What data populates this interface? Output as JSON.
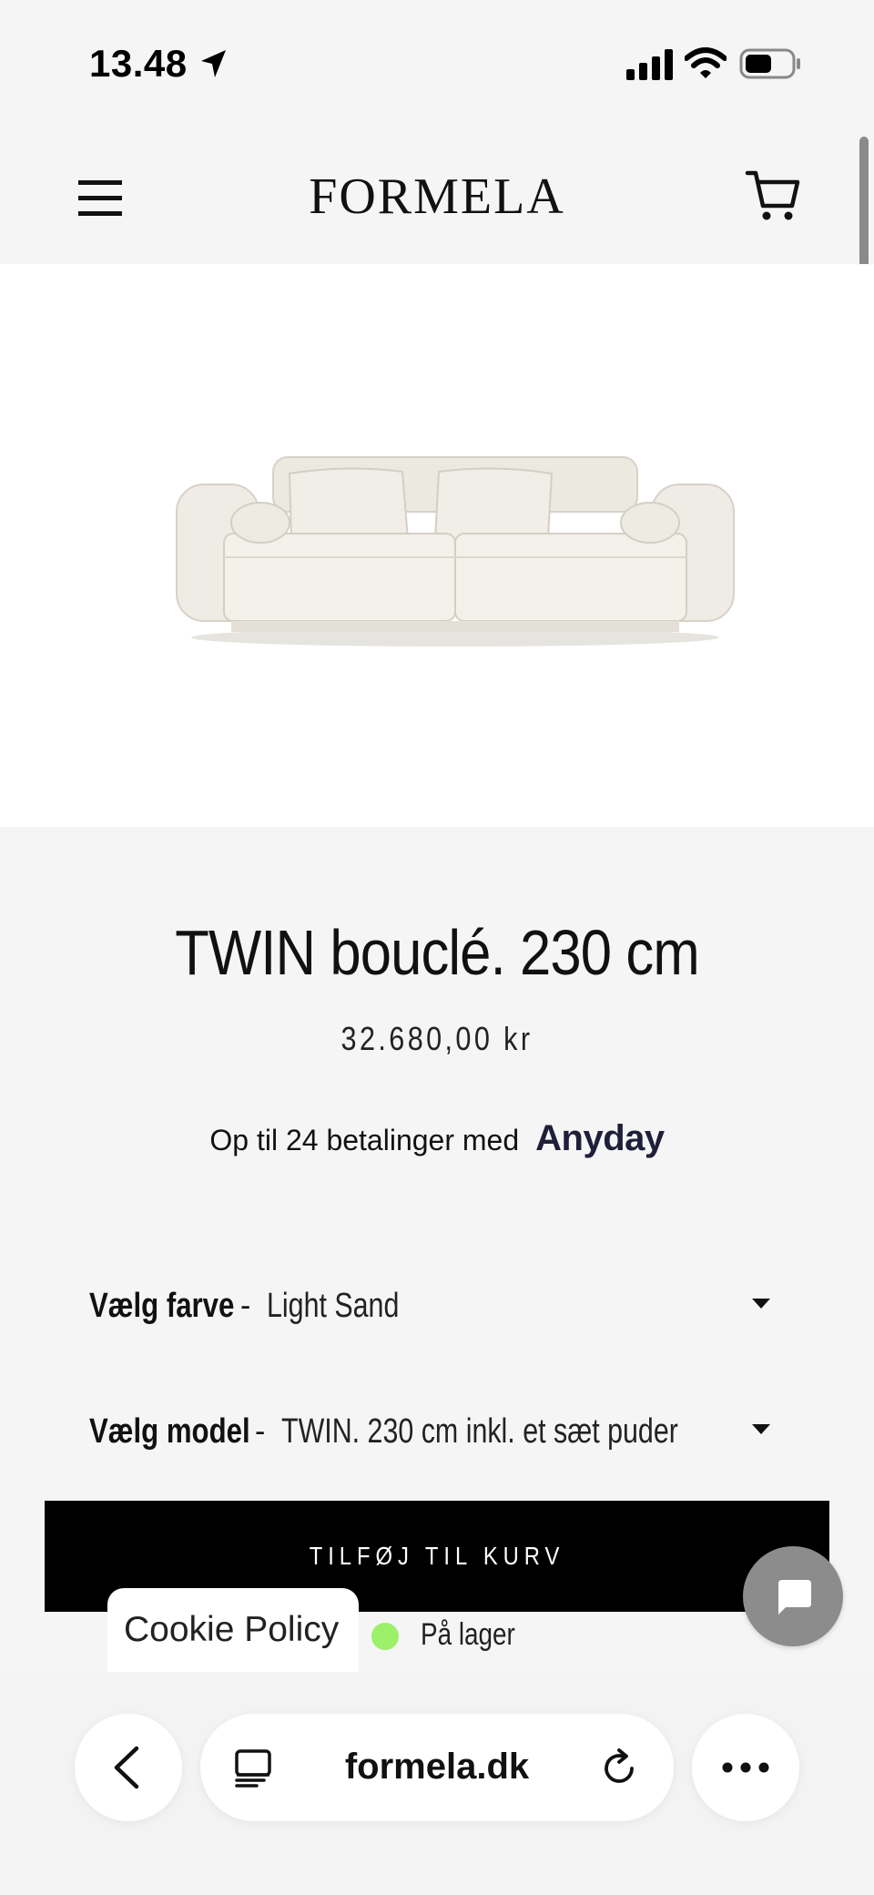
{
  "status_bar": {
    "time": "13.48"
  },
  "header": {
    "brand": "FORMELA",
    "icons": [
      "menu-icon",
      "cart-icon"
    ]
  },
  "product": {
    "title": "TWIN bouclé. 230 cm",
    "price": "32.680,00 kr",
    "installments_text": "Op til 24 betalinger med",
    "installments_provider": "Anyday",
    "options": {
      "color_label": "Vælg farve",
      "color_value": "Light Sand",
      "model_label": "Vælg model",
      "model_value": "TWIN. 230 cm inkl. et sæt puder",
      "separator": "-"
    },
    "add_to_cart": "TILFØJ TIL KURV",
    "stock_status": "På lager"
  },
  "cookie_tab": "Cookie Policy",
  "browser": {
    "url": "formela.dk"
  },
  "colors": {
    "accent": "#000000",
    "stock": "#9df06a",
    "chat": "#8c8c8c"
  }
}
